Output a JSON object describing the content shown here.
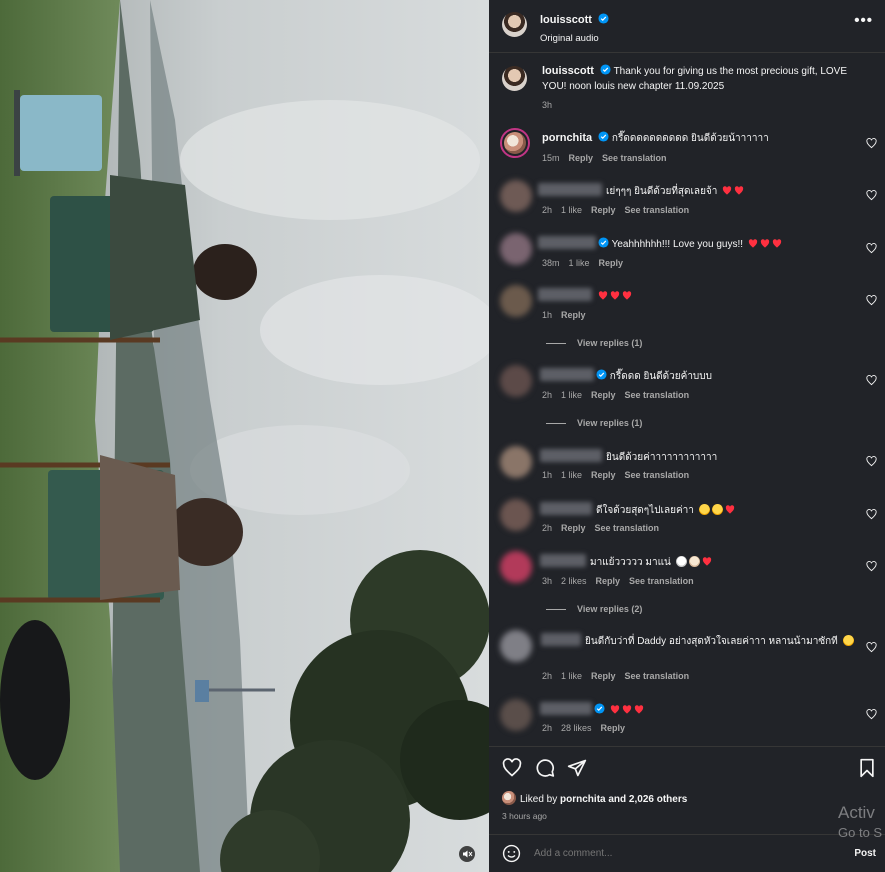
{
  "post": {
    "author": "louisscott",
    "audio": "Original audio",
    "caption_user": "louisscott",
    "caption": "Thank you for giving us the most precious gift, LOVE YOU! noon louis new chapter 11.09.2025",
    "caption_time": "3h"
  },
  "labels": {
    "reply": "Reply",
    "see_translation": "See translation",
    "view_replies_1": "View replies (1)",
    "view_replies_2": "View replies (2)"
  },
  "comments": [
    {
      "user": "pornchita",
      "verified": true,
      "text": "กรี๊ดดดดดดดดดด ยินดีด้วยน้าาาาาา",
      "time": "15m",
      "likes": ""
    },
    {
      "user": "",
      "verified": false,
      "text": "เย่ๆๆๆ ยินดีด้วยที่สุดเลยจ้า",
      "time": "2h",
      "likes": "1 like"
    },
    {
      "user": "",
      "verified": true,
      "text": "Yeahhhhhh!!! Love you guys!!",
      "time": "38m",
      "likes": "1 like"
    },
    {
      "user": "",
      "verified": false,
      "text": "",
      "time": "1h",
      "likes": ""
    },
    {
      "user": "",
      "verified": true,
      "text": "กรี๊ดดด ยินดีด้วยค้าบบบ",
      "time": "2h",
      "likes": "1 like"
    },
    {
      "user": "",
      "verified": false,
      "text": "ยินดีด้วยค่าาาาาาาาาาาา",
      "time": "1h",
      "likes": "1 like"
    },
    {
      "user": "",
      "verified": false,
      "text": "ดีใจด้วยสุดๆไปเลยค่าา",
      "time": "2h",
      "likes": ""
    },
    {
      "user": "",
      "verified": false,
      "text": "มาแย้ววววว มาแน่",
      "time": "3h",
      "likes": "2 likes"
    },
    {
      "user": "",
      "verified": false,
      "text": "ยินดีกับว่าที่ Daddy อย่างสุดหัวใจเลยค่าาา หลานน้ามาซักที",
      "time": "2h",
      "likes": "1 like"
    },
    {
      "user": "",
      "verified": true,
      "text": "",
      "time": "2h",
      "likes": "28 likes"
    }
  ],
  "footer": {
    "liked_by_prefix": "Liked by",
    "liked_by_user": "pornchita",
    "liked_by_suffix": "and 2,026 others",
    "time_ago": "3 hours ago",
    "add_comment_placeholder": "Add a comment...",
    "post_label": "Post"
  },
  "watermark": {
    "line1": "Activ",
    "line2": "Go to S"
  },
  "icons": {
    "verified": "verified-badge-icon",
    "more": "more-options-icon",
    "heart": "heart-outline-icon",
    "comment": "comment-icon",
    "share": "share-icon",
    "save": "bookmark-icon",
    "emoji": "emoji-icon",
    "mute": "speaker-muted-icon"
  },
  "colors": {
    "panel_bg": "#212328",
    "verified_blue": "#0095f6",
    "heart_red": "#ff3040",
    "secondary_text": "#a8a8a8"
  }
}
